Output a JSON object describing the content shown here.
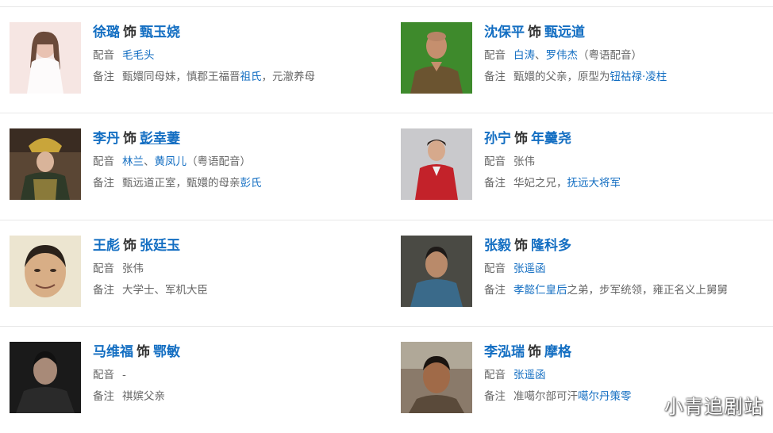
{
  "shi": "饰",
  "dubbing_label": "配音",
  "note_label": "备注",
  "watermark": "小青追剧站",
  "cast": [
    {
      "actor": "徐璐",
      "role": "甄玉娆",
      "dub": [
        {
          "t": "毛毛头",
          "l": true
        }
      ],
      "note": [
        {
          "t": "甄嬛同母妹，慎郡王福晋",
          "l": false
        },
        {
          "t": "祖氏",
          "l": true
        },
        {
          "t": "，元澈养母",
          "l": false
        }
      ]
    },
    {
      "actor": "沈保平",
      "role": "甄远道",
      "dub": [
        {
          "t": "白涛",
          "l": true
        },
        {
          "t": "、",
          "l": false
        },
        {
          "t": "罗伟杰",
          "l": true
        },
        {
          "t": "（粤语配音）",
          "l": false
        }
      ],
      "note": [
        {
          "t": "甄嬛的父亲，原型为",
          "l": false
        },
        {
          "t": "钮祜禄·凌柱",
          "l": true
        }
      ]
    },
    {
      "actor": "李丹",
      "role": "彭幸萋",
      "dub": [
        {
          "t": "林兰",
          "l": true
        },
        {
          "t": "、",
          "l": false
        },
        {
          "t": "黄凤儿",
          "l": true
        },
        {
          "t": "（粤语配音）",
          "l": false
        }
      ],
      "note": [
        {
          "t": "甄远道正室，甄嬛的母亲",
          "l": false
        },
        {
          "t": "彭氏",
          "l": true
        }
      ]
    },
    {
      "actor": "孙宁",
      "role": "年羹尧",
      "dub": [
        {
          "t": "张伟",
          "l": false
        }
      ],
      "note": [
        {
          "t": "华妃之兄，",
          "l": false
        },
        {
          "t": "抚远大将军",
          "l": true
        }
      ]
    },
    {
      "actor": "王彪",
      "role": "张廷玉",
      "dub": [
        {
          "t": "张伟",
          "l": false
        }
      ],
      "note": [
        {
          "t": "大学士、军机大臣",
          "l": false
        }
      ]
    },
    {
      "actor": "张毅",
      "role": "隆科多",
      "dub": [
        {
          "t": "张遥函",
          "l": true
        }
      ],
      "note": [
        {
          "t": "孝懿仁皇后",
          "l": true
        },
        {
          "t": "之弟，步军统领，雍正名义上舅舅",
          "l": false
        }
      ]
    },
    {
      "actor": "马维福",
      "role": "鄂敏",
      "dub": [
        {
          "t": "-",
          "l": false
        }
      ],
      "note": [
        {
          "t": "祺嫔父亲",
          "l": false
        }
      ]
    },
    {
      "actor": "李泓瑞",
      "role": "摩格",
      "dub": [
        {
          "t": "张遥函",
          "l": true
        }
      ],
      "note": [
        {
          "t": "准噶尔部可汗",
          "l": false
        },
        {
          "t": "噶尔丹策零",
          "l": true
        }
      ]
    }
  ]
}
